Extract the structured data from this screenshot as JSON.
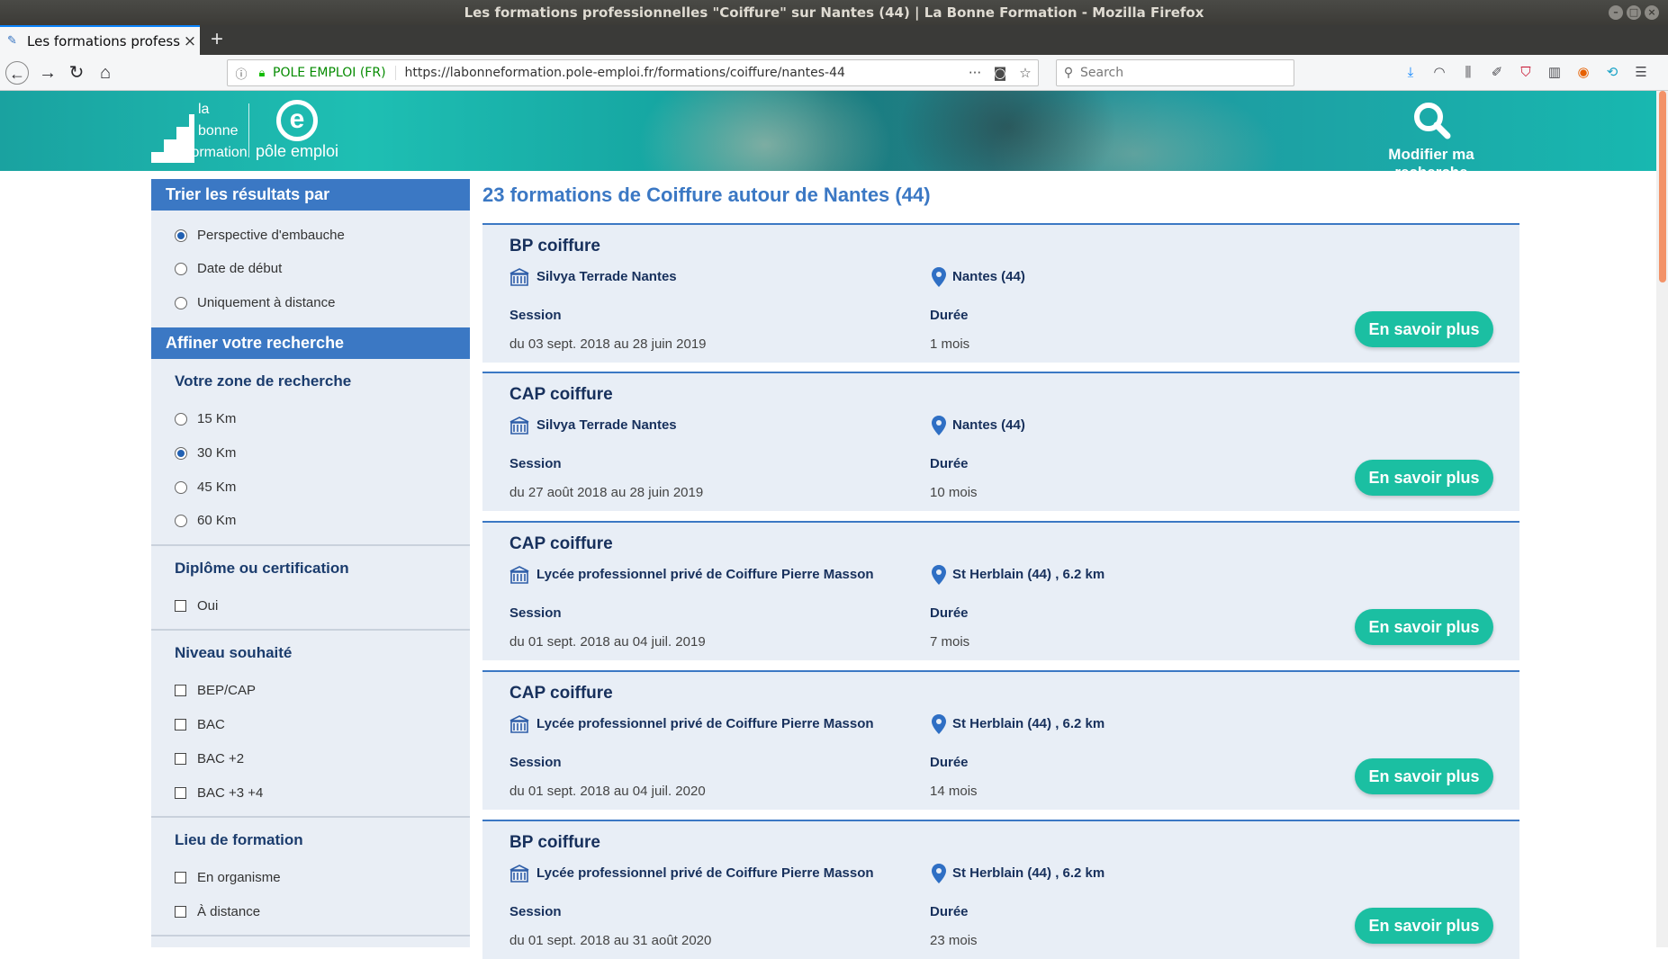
{
  "window": {
    "title": "Les formations professionnelles \"Coiffure\" sur Nantes (44) | La Bonne Formation - Mozilla Firefox"
  },
  "tab": {
    "title": "Les formations professi",
    "close": "×",
    "new": "+"
  },
  "nav": {
    "site_identity": "POLE EMPLOI (FR)",
    "url": "https://labonneformation.pole-emploi.fr/formations/coiffure/nantes-44",
    "search_placeholder": "Search"
  },
  "header": {
    "logo_la": "la",
    "logo_bonne": "bonne",
    "logo_formation": "formation",
    "logo_pe_letter": "e",
    "logo_pe_text": "pôle emploi",
    "modify_search": "Modifier ma recherche"
  },
  "sidebar": {
    "sort_heading": "Trier les résultats par",
    "sort_options": [
      "Perspective d'embauche",
      "Date de début",
      "Uniquement à distance"
    ],
    "refine_heading": "Affiner votre recherche",
    "zone_heading": "Votre zone de recherche",
    "zone_options": [
      "15 Km",
      "30 Km",
      "45 Km",
      "60 Km"
    ],
    "diploma_heading": "Diplôme ou certification",
    "diploma_options": [
      "Oui"
    ],
    "level_heading": "Niveau souhaité",
    "level_options": [
      "BEP/CAP",
      "BAC",
      "BAC +2",
      "BAC +3 +4"
    ],
    "place_heading": "Lieu de formation",
    "place_options": [
      "En organisme",
      "À distance"
    ]
  },
  "main": {
    "results_title": "23 formations de Coiffure autour de Nantes (44)",
    "session_label": "Session",
    "duration_label": "Durée",
    "more_label": "En savoir plus",
    "results": [
      {
        "title": "BP coiffure",
        "org": "Silvya Terrade Nantes",
        "location": "Nantes (44)",
        "session": "du 03 sept. 2018 au 28 juin 2019",
        "duration": "1 mois"
      },
      {
        "title": "CAP coiffure",
        "org": "Silvya Terrade Nantes",
        "location": "Nantes (44)",
        "session": "du 27 août 2018 au 28 juin 2019",
        "duration": "10 mois"
      },
      {
        "title": "CAP coiffure",
        "org": "Lycée professionnel privé de Coiffure Pierre Masson",
        "location": "St Herblain (44) , 6.2 km",
        "session": "du 01 sept. 2018 au 04 juil. 2019",
        "duration": "7 mois"
      },
      {
        "title": "CAP coiffure",
        "org": "Lycée professionnel privé de Coiffure Pierre Masson",
        "location": "St Herblain (44) , 6.2 km",
        "session": "du 01 sept. 2018 au 04 juil. 2020",
        "duration": "14 mois"
      },
      {
        "title": "BP coiffure",
        "org": "Lycée professionnel privé de Coiffure Pierre Masson",
        "location": "St Herblain (44) , 6.2 km",
        "session": "du 01 sept. 2018 au 31 août 2020",
        "duration": "23 mois"
      }
    ]
  }
}
